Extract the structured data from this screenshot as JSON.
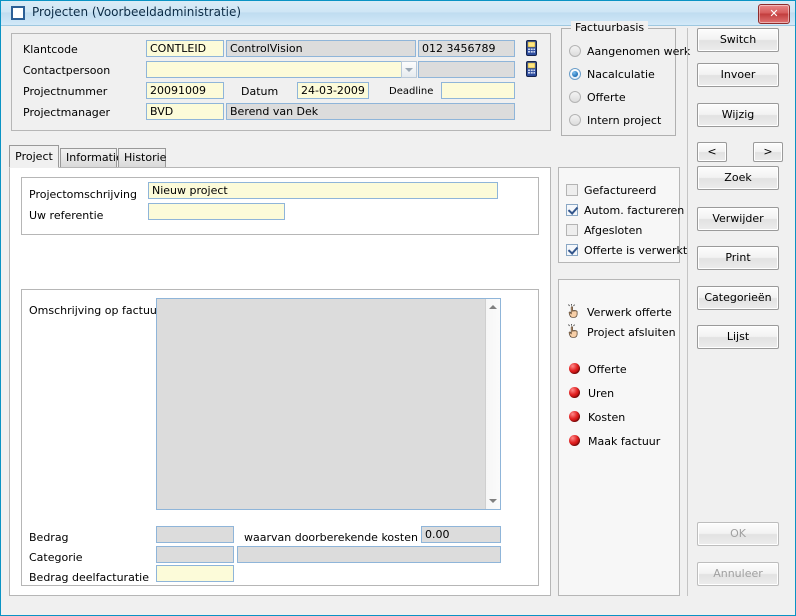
{
  "window": {
    "title": "Projecten (Voorbeeldadministratie)",
    "icon": "window-square-icon",
    "close_label": "✕",
    "accent": "#0a93c4"
  },
  "header": {
    "labels": {
      "klantcode": "Klantcode",
      "contactpersoon": "Contactpersoon",
      "projectnummer": "Projectnummer",
      "datum": "Datum",
      "deadline": "Deadline",
      "projectmanager": "Projectmanager"
    },
    "values": {
      "klantcode": "CONTLEID",
      "klantnaam": "ControlVision",
      "telefoon": "012 3456789",
      "contactpersoon": "",
      "contact_telefoon": "",
      "projectnummer": "20091009",
      "datum": "24-03-2009",
      "deadline": "",
      "projectmanager_code": "BVD",
      "projectmanager_naam": "Berend van Dek"
    },
    "phone_icon": "mobile-phone-icon",
    "dropdown_icon": "chevron-down-icon"
  },
  "factuurbasis": {
    "legend": "Factuurbasis",
    "options": [
      {
        "label": "Aangenomen werk",
        "selected": false
      },
      {
        "label": "Nacalculatie",
        "selected": true
      },
      {
        "label": "Offerte",
        "selected": false
      },
      {
        "label": "Intern project",
        "selected": false
      }
    ]
  },
  "tabs": [
    {
      "label": "Project",
      "selected": true
    },
    {
      "label": "Informatie",
      "selected": false
    },
    {
      "label": "Historie",
      "selected": false
    }
  ],
  "project_tab": {
    "projectomschrijving_label": "Projectomschrijving",
    "projectomschrijving_value": "Nieuw project",
    "uw_referentie_label": "Uw referentie",
    "uw_referentie_value": "",
    "omschrijving_factuur_label": "Omschrijving op factuur",
    "omschrijving_factuur_value": "",
    "bedrag_label": "Bedrag",
    "bedrag_value": "",
    "doorberekende_label": "waarvan doorberekende kosten",
    "doorberekende_value": "0.00",
    "categorie_label": "Categorie",
    "categorie_code": "",
    "categorie_naam": "",
    "bedrag_deelfacturatie_label": "Bedrag deelfacturatie",
    "bedrag_deelfacturatie_value": ""
  },
  "status_checks": [
    {
      "label": "Gefactureerd",
      "checked": false
    },
    {
      "label": "Autom. factureren",
      "checked": true
    },
    {
      "label": "Afgesloten",
      "checked": false
    },
    {
      "label": "Offerte is verwerkt",
      "checked": true
    }
  ],
  "actions": [
    {
      "label": "Verwerk offerte",
      "icon": "pointing-hand-click-icon"
    },
    {
      "label": "Project afsluiten",
      "icon": "pointing-hand-click-icon"
    }
  ],
  "indicators": [
    {
      "label": "Offerte",
      "color": "#e01f1f",
      "icon": "red-led-icon"
    },
    {
      "label": "Uren",
      "color": "#e01f1f",
      "icon": "red-led-icon"
    },
    {
      "label": "Kosten",
      "color": "#e01f1f",
      "icon": "red-led-icon"
    },
    {
      "label": "Maak factuur",
      "color": "#e01f1f",
      "icon": "red-led-icon"
    }
  ],
  "sidebar_buttons": [
    {
      "label": "Switch",
      "disabled": false
    },
    {
      "label": "Invoer",
      "disabled": false
    },
    {
      "label": "Wijzig",
      "disabled": false
    },
    {
      "label": "Zoek",
      "disabled": false
    },
    {
      "label": "Verwijder",
      "disabled": false
    },
    {
      "label": "Print",
      "disabled": false
    },
    {
      "label": "Categorieën",
      "disabled": false
    },
    {
      "label": "Lijst",
      "disabled": false
    }
  ],
  "nav": {
    "prev_label": "<",
    "next_label": ">"
  },
  "footer_buttons": [
    {
      "label": "OK",
      "disabled": true
    },
    {
      "label": "Annuleer",
      "disabled": true
    }
  ]
}
